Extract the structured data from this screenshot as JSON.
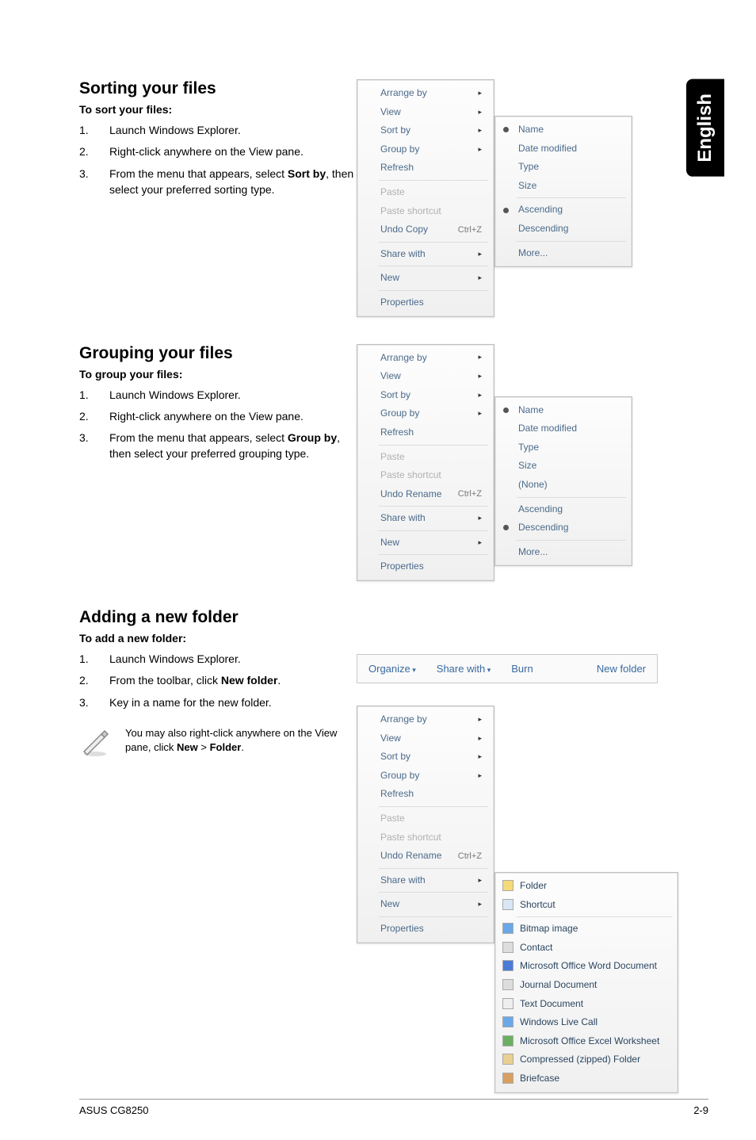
{
  "language_tab": "English",
  "sections": {
    "sort": {
      "heading": "Sorting your files",
      "subhead": "To sort your files:",
      "steps": [
        "Launch Windows Explorer.",
        "Right-click anywhere on the View pane.",
        "From the menu that appears, select Sort by, then select your preferred sorting type."
      ],
      "step3_prefix": "From the menu that appears, select ",
      "step3_bold": "Sort by",
      "step3_suffix": ", then select your preferred sorting type."
    },
    "group": {
      "heading": "Grouping your files",
      "subhead": "To group your files:",
      "steps": [
        "Launch Windows Explorer.",
        "Right-click anywhere on the View pane."
      ],
      "step3_prefix": "From the menu that appears, select ",
      "step3_bold": "Group by",
      "step3_suffix": ", then select your preferred grouping type."
    },
    "folder": {
      "heading": "Adding a new folder",
      "subhead": "To add a new folder:",
      "steps": [
        "Launch Windows Explorer."
      ],
      "step2_prefix": "From the toolbar, click ",
      "step2_bold": "New folder",
      "step2_suffix": ".",
      "step3": "Key in a name for the new folder.",
      "note_prefix": "You may also right-click anywhere on the View pane, click ",
      "note_bold1": "New",
      "note_mid": " > ",
      "note_bold2": "Folder",
      "note_suffix": "."
    }
  },
  "context_menu": {
    "arrange_by": "Arrange by",
    "view": "View",
    "sort_by": "Sort by",
    "group_by": "Group by",
    "refresh": "Refresh",
    "paste": "Paste",
    "paste_shortcut": "Paste shortcut",
    "undo_copy": "Undo Copy",
    "undo_rename": "Undo Rename",
    "ctrl_z": "Ctrl+Z",
    "share_with": "Share with",
    "new": "New",
    "properties": "Properties"
  },
  "sort_submenu": {
    "name": "Name",
    "date_modified": "Date modified",
    "type": "Type",
    "size": "Size",
    "ascending": "Ascending",
    "descending": "Descending",
    "more": "More..."
  },
  "group_submenu": {
    "name": "Name",
    "date_modified": "Date modified",
    "type": "Type",
    "size": "Size",
    "none": "(None)",
    "ascending": "Ascending",
    "descending": "Descending",
    "more": "More..."
  },
  "toolbar": {
    "organize": "Organize",
    "share_with": "Share with",
    "burn": "Burn",
    "new_folder": "New folder"
  },
  "new_submenu": {
    "folder": "Folder",
    "shortcut": "Shortcut",
    "bitmap": "Bitmap image",
    "contact": "Contact",
    "word": "Microsoft Office Word Document",
    "journal": "Journal Document",
    "text": "Text Document",
    "wlc": "Windows Live Call",
    "excel": "Microsoft Office Excel Worksheet",
    "zip": "Compressed (zipped) Folder",
    "briefcase": "Briefcase"
  },
  "footer": {
    "left": "ASUS CG8250",
    "right": "2-9"
  }
}
